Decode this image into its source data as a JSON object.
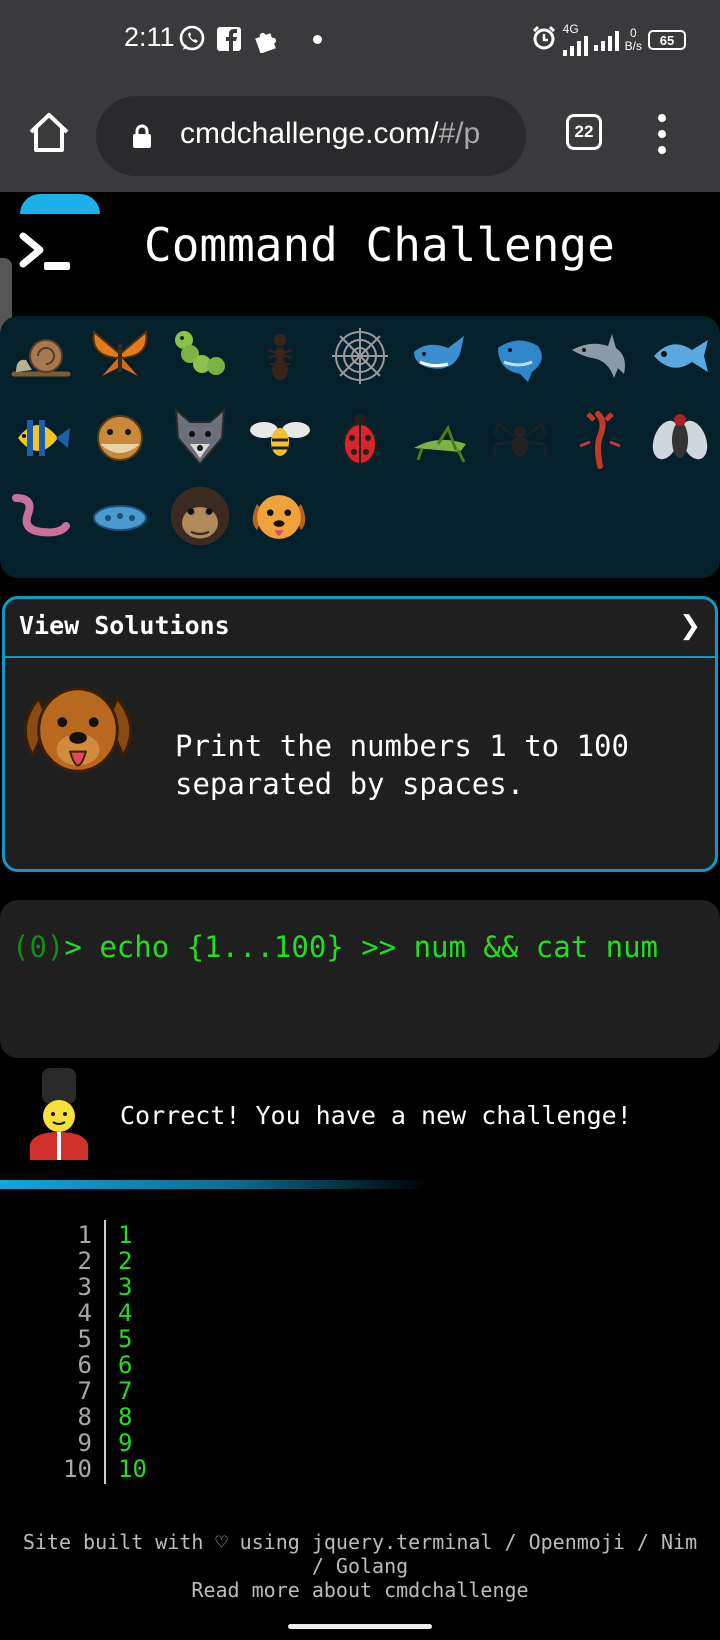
{
  "status_bar": {
    "time": "2:11",
    "battery": "65",
    "network": "4G",
    "data_rate_value": "0",
    "data_rate_unit": "B/s",
    "icons": [
      "whatsapp-icon",
      "facebook-icon",
      "puzzle-icon",
      "alarm-icon",
      "signal-icon",
      "battery-icon"
    ]
  },
  "browser": {
    "url_main": "cmdchallenge.com/",
    "url_dim": "#/p",
    "tab_count": "22"
  },
  "header": {
    "title": "Command Challenge"
  },
  "emoji_panel": {
    "items": [
      "snail",
      "butterfly",
      "caterpillar",
      "ant",
      "spider-web",
      "whale",
      "spouting-whale",
      "dolphin",
      "fish",
      "tropical-fish",
      "blowfish",
      "wolf",
      "honeybee",
      "lady-beetle",
      "cricket",
      "spider",
      "scorpion",
      "fly",
      "worm",
      "microbe",
      "gorilla",
      "dog-face"
    ]
  },
  "challenge": {
    "solutions_label": "View Solutions",
    "chevron": "❯",
    "description": "Print the numbers 1 to 100 separated by spaces.",
    "mascot_icon": "dog-face-icon"
  },
  "terminal": {
    "status": "(0)",
    "prompt": "> ",
    "command": "echo {1...100} >> num && cat num"
  },
  "result": {
    "message": "Correct! You have a new challenge!",
    "mascot_icon": "guard-icon"
  },
  "output": {
    "line_numbers": [
      "1",
      "2",
      "3",
      "4",
      "5",
      "6",
      "7",
      "8",
      "9",
      "10"
    ],
    "lines": [
      "1",
      "2",
      "3",
      "4",
      "5",
      "6",
      "7",
      "8",
      "9",
      "10"
    ]
  },
  "footer": {
    "credits_line1": "Site built with ♡ using jquery.terminal / Openmoji / Nim",
    "credits_line2": "/ Golang",
    "read_more": "Read more about cmdchallenge"
  },
  "colors": {
    "accent": "#1596c4",
    "terminal_green": "#22dd22",
    "panel_bg": "#04202b",
    "card_bg": "#1f1f1f"
  }
}
